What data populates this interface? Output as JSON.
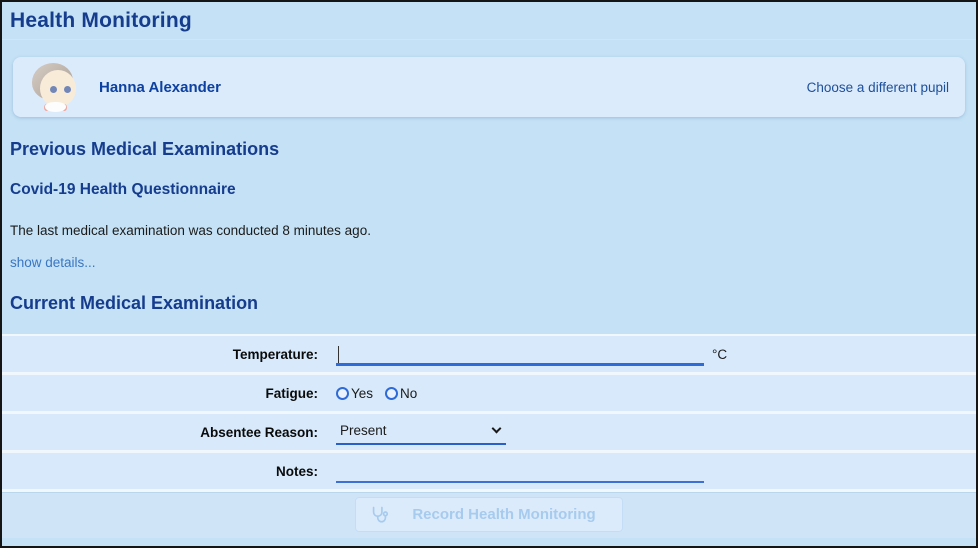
{
  "page": {
    "title": "Health Monitoring"
  },
  "pupil_card": {
    "name": "Hanna Alexander",
    "change_link": "Choose a different pupil",
    "avatar_icon": "pupil-avatar"
  },
  "previous_exams": {
    "heading": "Previous Medical Examinations",
    "questionnaire_title": "Covid-19 Health Questionnaire",
    "summary": "The last medical examination was conducted 8 minutes ago.",
    "details_link": "show details..."
  },
  "current_exam": {
    "heading": "Current Medical Examination",
    "fields": {
      "temperature": {
        "label": "Temperature:",
        "value": "",
        "unit": "°C",
        "focused": true
      },
      "fatigue": {
        "label": "Fatigue:",
        "options": [
          "Yes",
          "No"
        ],
        "selected": ""
      },
      "absentee_reason": {
        "label": "Absentee Reason:",
        "selected_option": "Present"
      },
      "notes": {
        "label": "Notes:",
        "value": ""
      }
    },
    "submit": {
      "label": "Record Health Monitoring",
      "icon": "stethoscope-icon",
      "enabled": false
    }
  },
  "colors": {
    "page_background": "#c4e1f5",
    "card_background": "#dcebfb",
    "row_background": "#d7e9fb",
    "footer_background": "#cfe5f7",
    "heading": "#163c8e",
    "pupil_name": "#0d41a1",
    "link": "#1c4f9c",
    "details_link": "#3a76c4",
    "input_underline": "#2e6bd8",
    "disabled_button_text": "#a6cbee",
    "window_border": "#151515"
  }
}
